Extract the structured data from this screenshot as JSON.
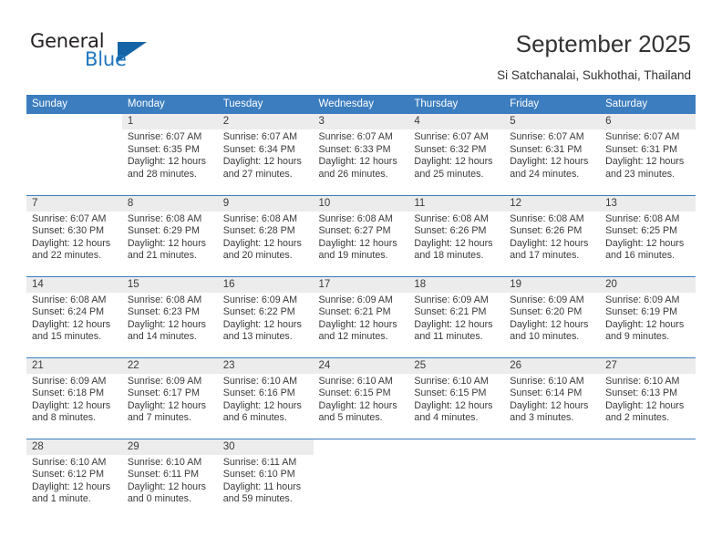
{
  "brand": {
    "name_part1": "General",
    "name_part2": "Blue",
    "triangle_icon": "triangle-icon",
    "colors": {
      "dark": "#231f20",
      "blue": "#1f76bd",
      "header_blue": "#3b7dbf",
      "band_gray": "#ececec"
    }
  },
  "header": {
    "title": "September 2025",
    "subtitle": "Si Satchanalai, Sukhothai, Thailand"
  },
  "calendar": {
    "weekday_headers": [
      "Sunday",
      "Monday",
      "Tuesday",
      "Wednesday",
      "Thursday",
      "Friday",
      "Saturday"
    ],
    "weeks": [
      [
        {
          "day": "",
          "sunrise": "",
          "sunset": "",
          "daylight1": "",
          "daylight2": "",
          "empty": true
        },
        {
          "day": "1",
          "sunrise": "Sunrise: 6:07 AM",
          "sunset": "Sunset: 6:35 PM",
          "daylight1": "Daylight: 12 hours",
          "daylight2": "and 28 minutes."
        },
        {
          "day": "2",
          "sunrise": "Sunrise: 6:07 AM",
          "sunset": "Sunset: 6:34 PM",
          "daylight1": "Daylight: 12 hours",
          "daylight2": "and 27 minutes."
        },
        {
          "day": "3",
          "sunrise": "Sunrise: 6:07 AM",
          "sunset": "Sunset: 6:33 PM",
          "daylight1": "Daylight: 12 hours",
          "daylight2": "and 26 minutes."
        },
        {
          "day": "4",
          "sunrise": "Sunrise: 6:07 AM",
          "sunset": "Sunset: 6:32 PM",
          "daylight1": "Daylight: 12 hours",
          "daylight2": "and 25 minutes."
        },
        {
          "day": "5",
          "sunrise": "Sunrise: 6:07 AM",
          "sunset": "Sunset: 6:31 PM",
          "daylight1": "Daylight: 12 hours",
          "daylight2": "and 24 minutes."
        },
        {
          "day": "6",
          "sunrise": "Sunrise: 6:07 AM",
          "sunset": "Sunset: 6:31 PM",
          "daylight1": "Daylight: 12 hours",
          "daylight2": "and 23 minutes."
        }
      ],
      [
        {
          "day": "7",
          "sunrise": "Sunrise: 6:07 AM",
          "sunset": "Sunset: 6:30 PM",
          "daylight1": "Daylight: 12 hours",
          "daylight2": "and 22 minutes."
        },
        {
          "day": "8",
          "sunrise": "Sunrise: 6:08 AM",
          "sunset": "Sunset: 6:29 PM",
          "daylight1": "Daylight: 12 hours",
          "daylight2": "and 21 minutes."
        },
        {
          "day": "9",
          "sunrise": "Sunrise: 6:08 AM",
          "sunset": "Sunset: 6:28 PM",
          "daylight1": "Daylight: 12 hours",
          "daylight2": "and 20 minutes."
        },
        {
          "day": "10",
          "sunrise": "Sunrise: 6:08 AM",
          "sunset": "Sunset: 6:27 PM",
          "daylight1": "Daylight: 12 hours",
          "daylight2": "and 19 minutes."
        },
        {
          "day": "11",
          "sunrise": "Sunrise: 6:08 AM",
          "sunset": "Sunset: 6:26 PM",
          "daylight1": "Daylight: 12 hours",
          "daylight2": "and 18 minutes."
        },
        {
          "day": "12",
          "sunrise": "Sunrise: 6:08 AM",
          "sunset": "Sunset: 6:26 PM",
          "daylight1": "Daylight: 12 hours",
          "daylight2": "and 17 minutes."
        },
        {
          "day": "13",
          "sunrise": "Sunrise: 6:08 AM",
          "sunset": "Sunset: 6:25 PM",
          "daylight1": "Daylight: 12 hours",
          "daylight2": "and 16 minutes."
        }
      ],
      [
        {
          "day": "14",
          "sunrise": "Sunrise: 6:08 AM",
          "sunset": "Sunset: 6:24 PM",
          "daylight1": "Daylight: 12 hours",
          "daylight2": "and 15 minutes."
        },
        {
          "day": "15",
          "sunrise": "Sunrise: 6:08 AM",
          "sunset": "Sunset: 6:23 PM",
          "daylight1": "Daylight: 12 hours",
          "daylight2": "and 14 minutes."
        },
        {
          "day": "16",
          "sunrise": "Sunrise: 6:09 AM",
          "sunset": "Sunset: 6:22 PM",
          "daylight1": "Daylight: 12 hours",
          "daylight2": "and 13 minutes."
        },
        {
          "day": "17",
          "sunrise": "Sunrise: 6:09 AM",
          "sunset": "Sunset: 6:21 PM",
          "daylight1": "Daylight: 12 hours",
          "daylight2": "and 12 minutes."
        },
        {
          "day": "18",
          "sunrise": "Sunrise: 6:09 AM",
          "sunset": "Sunset: 6:21 PM",
          "daylight1": "Daylight: 12 hours",
          "daylight2": "and 11 minutes."
        },
        {
          "day": "19",
          "sunrise": "Sunrise: 6:09 AM",
          "sunset": "Sunset: 6:20 PM",
          "daylight1": "Daylight: 12 hours",
          "daylight2": "and 10 minutes."
        },
        {
          "day": "20",
          "sunrise": "Sunrise: 6:09 AM",
          "sunset": "Sunset: 6:19 PM",
          "daylight1": "Daylight: 12 hours",
          "daylight2": "and 9 minutes."
        }
      ],
      [
        {
          "day": "21",
          "sunrise": "Sunrise: 6:09 AM",
          "sunset": "Sunset: 6:18 PM",
          "daylight1": "Daylight: 12 hours",
          "daylight2": "and 8 minutes."
        },
        {
          "day": "22",
          "sunrise": "Sunrise: 6:09 AM",
          "sunset": "Sunset: 6:17 PM",
          "daylight1": "Daylight: 12 hours",
          "daylight2": "and 7 minutes."
        },
        {
          "day": "23",
          "sunrise": "Sunrise: 6:10 AM",
          "sunset": "Sunset: 6:16 PM",
          "daylight1": "Daylight: 12 hours",
          "daylight2": "and 6 minutes."
        },
        {
          "day": "24",
          "sunrise": "Sunrise: 6:10 AM",
          "sunset": "Sunset: 6:15 PM",
          "daylight1": "Daylight: 12 hours",
          "daylight2": "and 5 minutes."
        },
        {
          "day": "25",
          "sunrise": "Sunrise: 6:10 AM",
          "sunset": "Sunset: 6:15 PM",
          "daylight1": "Daylight: 12 hours",
          "daylight2": "and 4 minutes."
        },
        {
          "day": "26",
          "sunrise": "Sunrise: 6:10 AM",
          "sunset": "Sunset: 6:14 PM",
          "daylight1": "Daylight: 12 hours",
          "daylight2": "and 3 minutes."
        },
        {
          "day": "27",
          "sunrise": "Sunrise: 6:10 AM",
          "sunset": "Sunset: 6:13 PM",
          "daylight1": "Daylight: 12 hours",
          "daylight2": "and 2 minutes."
        }
      ],
      [
        {
          "day": "28",
          "sunrise": "Sunrise: 6:10 AM",
          "sunset": "Sunset: 6:12 PM",
          "daylight1": "Daylight: 12 hours",
          "daylight2": "and 1 minute."
        },
        {
          "day": "29",
          "sunrise": "Sunrise: 6:10 AM",
          "sunset": "Sunset: 6:11 PM",
          "daylight1": "Daylight: 12 hours",
          "daylight2": "and 0 minutes."
        },
        {
          "day": "30",
          "sunrise": "Sunrise: 6:11 AM",
          "sunset": "Sunset: 6:10 PM",
          "daylight1": "Daylight: 11 hours",
          "daylight2": "and 59 minutes."
        },
        {
          "day": "",
          "sunrise": "",
          "sunset": "",
          "daylight1": "",
          "daylight2": "",
          "empty": true
        },
        {
          "day": "",
          "sunrise": "",
          "sunset": "",
          "daylight1": "",
          "daylight2": "",
          "empty": true
        },
        {
          "day": "",
          "sunrise": "",
          "sunset": "",
          "daylight1": "",
          "daylight2": "",
          "empty": true
        },
        {
          "day": "",
          "sunrise": "",
          "sunset": "",
          "daylight1": "",
          "daylight2": "",
          "empty": true
        }
      ]
    ]
  }
}
